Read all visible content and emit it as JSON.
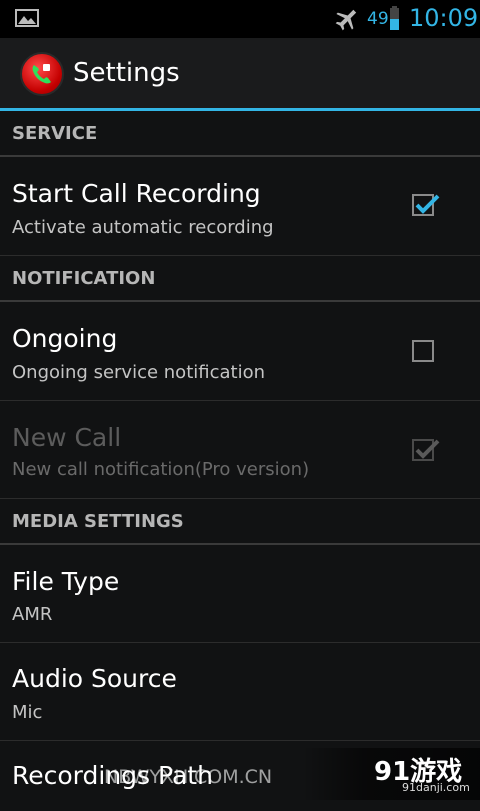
{
  "status_bar": {
    "battery_level": "49",
    "time": "10:09",
    "icons": [
      "image-icon",
      "airplane-mode-icon",
      "battery-icon"
    ]
  },
  "action_bar": {
    "title": "Settings",
    "app_icon": "call-recorder-icon"
  },
  "sections": [
    {
      "header": "SERVICE",
      "items": [
        {
          "title": "Start Call Recording",
          "summary": "Activate automatic recording",
          "checked": true,
          "enabled": true
        }
      ]
    },
    {
      "header": "NOTIFICATION",
      "items": [
        {
          "title": "Ongoing",
          "summary": "Ongoing service notification",
          "checked": false,
          "enabled": true
        },
        {
          "title": "New Call",
          "summary": "New call notification(Pro version)",
          "checked": true,
          "enabled": false
        }
      ]
    },
    {
      "header": "MEDIA SETTINGS",
      "items": [
        {
          "title": "File Type",
          "summary": "AMR"
        },
        {
          "title": "Audio Source",
          "summary": "Mic"
        },
        {
          "title": "Recordings Path"
        }
      ]
    }
  ],
  "watermark": {
    "text": "NBWYXH.COM.CN",
    "logo": "91游戏",
    "logo_sub": "91danji.com"
  },
  "colors": {
    "accent": "#33b5e5",
    "background": "#111213",
    "header_text": "#b6b6b6"
  }
}
